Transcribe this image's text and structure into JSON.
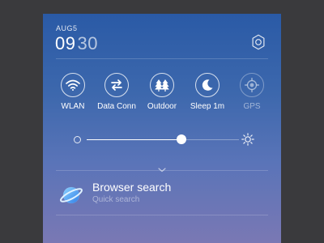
{
  "status": {
    "date": "AUG5",
    "time_hours": "09",
    "time_minutes": "30"
  },
  "quick_toggles": [
    {
      "label": "WLAN",
      "icon": "wifi-icon",
      "enabled": true
    },
    {
      "label": "Data Conn",
      "icon": "data-transfer-icon",
      "enabled": true
    },
    {
      "label": "Outdoor",
      "icon": "trees-icon",
      "enabled": true
    },
    {
      "label": "Sleep 1m",
      "icon": "moon-icon",
      "enabled": true
    },
    {
      "label": "GPS",
      "icon": "gps-target-icon",
      "enabled": false
    }
  ],
  "brightness": {
    "level": 0.62,
    "low_icon": "brightness-low-icon",
    "high_icon": "brightness-high-icon"
  },
  "expand_icon": "chevron-down-icon",
  "search": {
    "title": "Browser search",
    "subtitle": "Quick search",
    "icon": "planet-icon"
  },
  "colors": {
    "panel_top": "#2a5aa6",
    "panel_bottom": "#7a78b4",
    "background": "#3a3a3d",
    "accent": "#ffffff"
  }
}
